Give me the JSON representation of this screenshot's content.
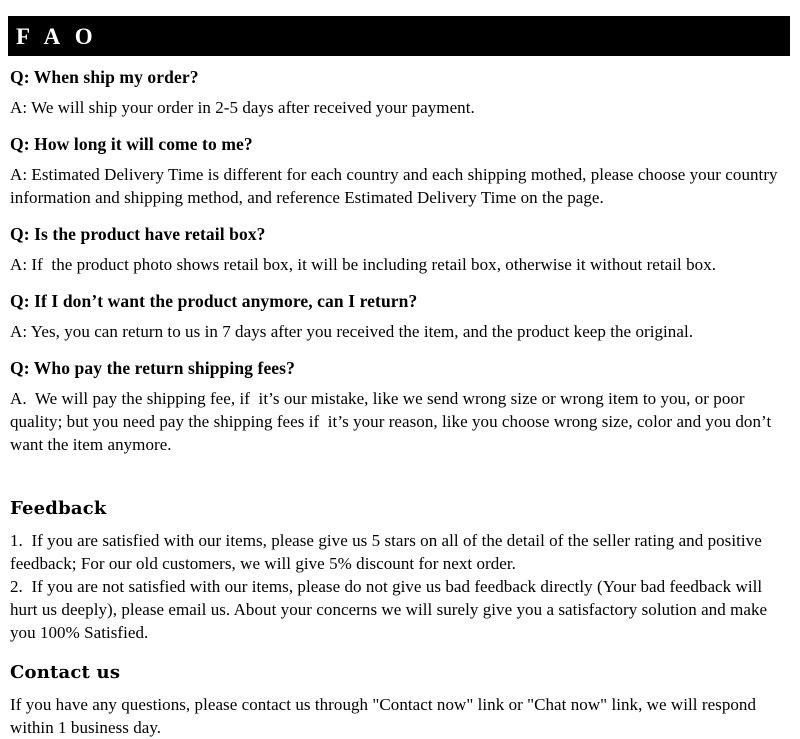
{
  "header": {
    "title": "F A O",
    "background_color": "#000000",
    "text_color": "#ffffff"
  },
  "faq": {
    "items": [
      {
        "question": "Q: When ship my order?",
        "answer": "A: We will ship your order in 2-5 days after received your payment."
      },
      {
        "question": "Q: How long it will come to me?",
        "answer": "A: Estimated Delivery Time is different for each country and each shipping mothed, please choose your country information and shipping method, and reference Estimated Delivery Time on the page."
      },
      {
        "question": "Q: Is the product have retail box?",
        "answer": "A: If  the product photo shows retail box, it will be including retail box, otherwise it without retail box."
      },
      {
        "question": "Q: If  I don’t want the product anymore, can I return?",
        "answer": "A: Yes, you can return to us in 7 days after you received the item, and the product keep the original."
      },
      {
        "question": "Q: Who pay the return shipping fees?",
        "answer": "A.  We will pay the shipping fee, if  it’s our mistake, like we send wrong size or wrong item to you, or poor quality; but you need pay the shipping fees if  it’s your reason, like you choose wrong size, color and you don’t want the item anymore."
      }
    ]
  },
  "feedback": {
    "heading": "Feedback",
    "item_1": "1.  If you are satisfied with our items, please give us 5 stars on all of the detail of the seller rating and positive feedback; For our old customers, we will give 5% discount for next order.",
    "item_2": "2.  If you are not satisfied with our items, please do not give us bad feedback directly (Your bad feedback will hurt us deeply), please email us. About your concerns we will surely give you a satisfactory solution and make you 100% Satisfied."
  },
  "contact": {
    "heading": "Contact us",
    "body": "If you have any questions, please contact us through \"Contact now\" link or \"Chat now\" link, we will respond within 1 business day."
  }
}
